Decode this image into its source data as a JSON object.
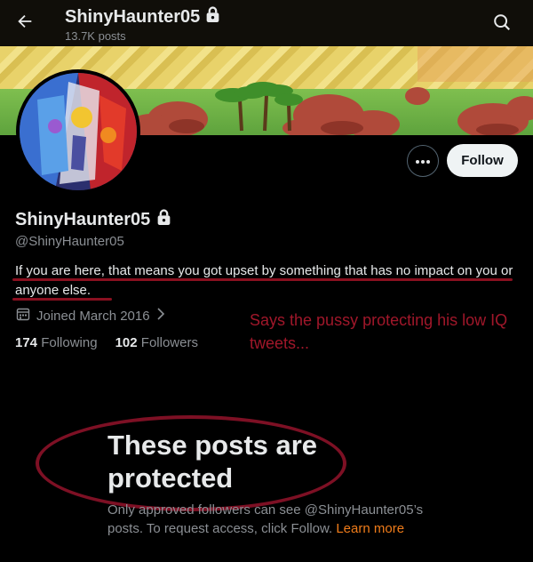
{
  "header": {
    "display_name": "ShinyHaunter05",
    "post_count": "13.7K posts"
  },
  "profile": {
    "display_name": "ShinyHaunter05",
    "handle": "@ShinyHaunter05",
    "bio": "If you are here, that means you got upset by something that has no impact on you or anyone else.",
    "joined": "Joined March 2016",
    "following_count": "174",
    "following_label": "Following",
    "followers_count": "102",
    "followers_label": "Followers"
  },
  "actions": {
    "follow_label": "Follow"
  },
  "annotation": {
    "text": "Says the pussy protecting his low IQ tweets..."
  },
  "protected": {
    "title": "These posts are protected",
    "desc_prefix": "Only approved followers can see @ShinyHaunter05’s posts. To request access, click Follow.",
    "learn_more": "Learn more"
  },
  "icons": {
    "back": "back-arrow-icon",
    "lock": "lock-icon",
    "search": "search-icon",
    "more": "more-dots-icon",
    "calendar": "calendar-icon",
    "chevron": "chevron-right-icon"
  },
  "colors": {
    "background": "#000000",
    "annotation_red": "#a0172a",
    "link_orange": "#f07c1a",
    "follow_button": "#eff3f4"
  }
}
